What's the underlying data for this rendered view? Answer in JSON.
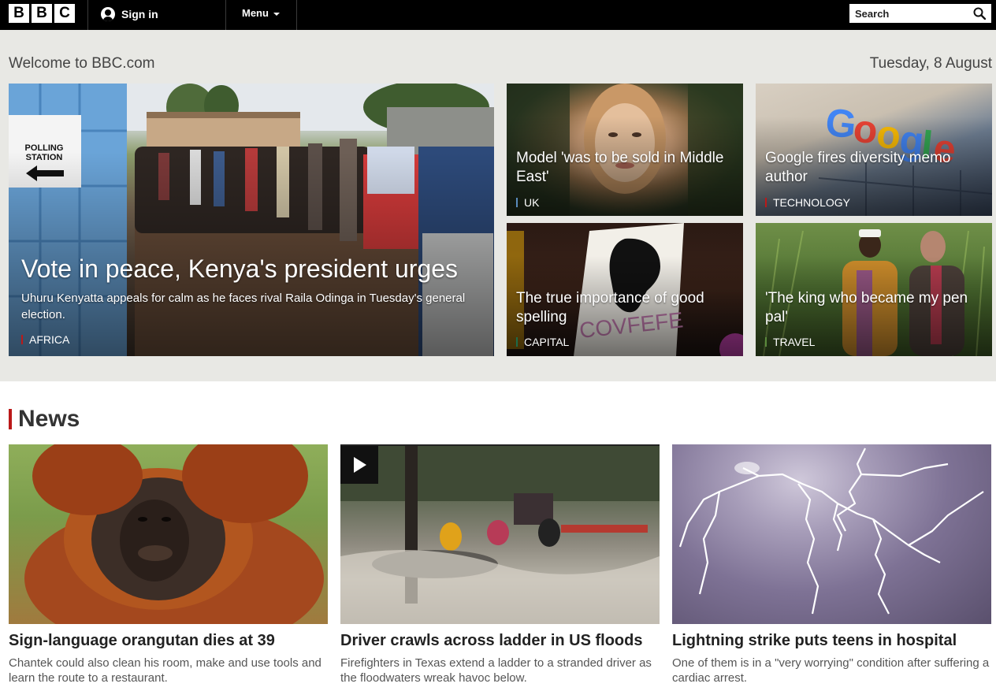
{
  "header": {
    "logo_letters": [
      "B",
      "B",
      "C"
    ],
    "signin_label": "Sign in",
    "menu_label": "Menu",
    "search_placeholder": "Search"
  },
  "hero": {
    "welcome": "Welcome to BBC.com",
    "date": "Tuesday, 8 August",
    "lead": {
      "title": "Vote in peace, Kenya's president urges",
      "summary": "Uhuru Kenyatta appeals for calm as he faces rival Raila Odinga in Tuesday's general election.",
      "tag": "AFRICA",
      "tag_color": "#bb1919",
      "sign_text": "POLLING STATION"
    },
    "tiles": [
      {
        "title": "Model 'was to be sold in Middle East'",
        "tag": "UK",
        "tag_color": "#5a8bbd"
      },
      {
        "title": "Google fires diversity memo author",
        "tag": "TECHNOLOGY",
        "tag_color": "#bb1919"
      },
      {
        "title": "The true importance of good spelling",
        "tag": "CAPITAL",
        "tag_color": "#1d6b4a"
      },
      {
        "title": "'The king who became my pen pal'",
        "tag": "TRAVEL",
        "tag_color": "#5a8a3c"
      }
    ]
  },
  "news": {
    "heading": "News",
    "accent_color": "#bb1919",
    "cards": [
      {
        "title": "Sign-language orangutan dies at 39",
        "summary": "Chantek could also clean his room, make and use tools and learn the route to a restaurant.",
        "video": false
      },
      {
        "title": "Driver crawls across ladder in US floods",
        "summary": "Firefighters in Texas extend a ladder to a stranded driver as the floodwaters wreak havoc below.",
        "video": true
      },
      {
        "title": "Lightning strike puts teens in hospital",
        "summary": "One of them is in a \"very worrying\" condition after suffering a cardiac arrest.",
        "video": false
      }
    ]
  },
  "icons": {
    "search": "search-icon",
    "user": "user-icon",
    "caret": "chevron-down-icon",
    "play": "play-icon"
  }
}
